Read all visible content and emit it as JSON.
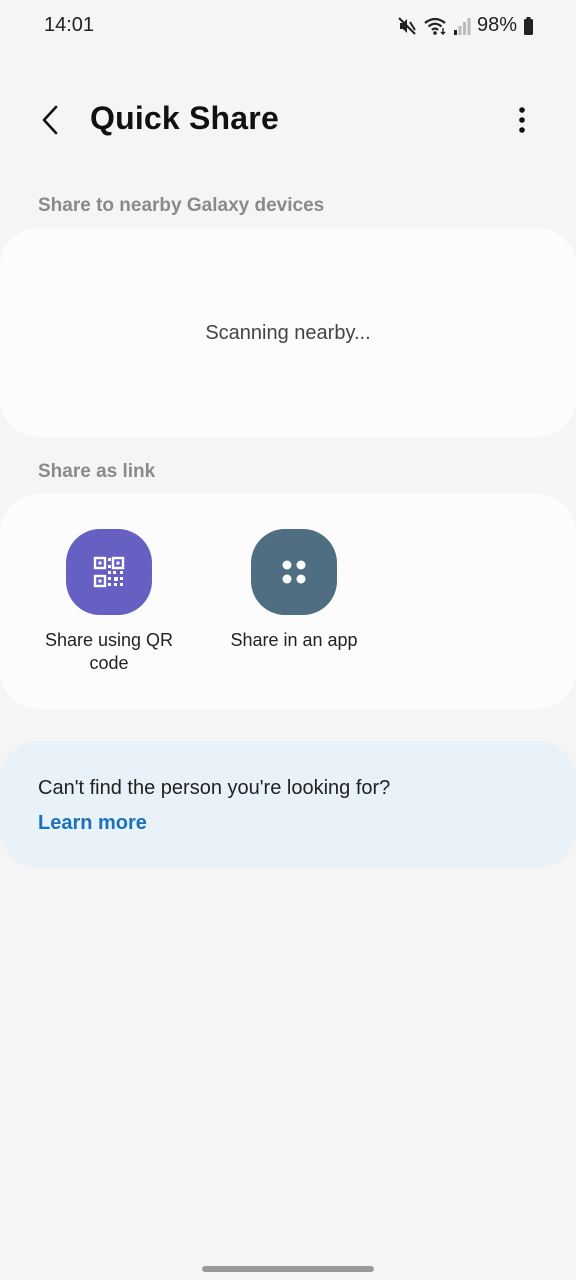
{
  "status_bar": {
    "time": "14:01",
    "battery": "98%",
    "icons": [
      "mute-icon",
      "wifi-icon",
      "signal-icon",
      "battery-icon"
    ]
  },
  "header": {
    "title": "Quick Share",
    "back_icon": "chevron-left-icon",
    "more_icon": "more-vert-icon"
  },
  "nearby": {
    "label": "Share to nearby Galaxy devices",
    "status": "Scanning nearby..."
  },
  "link": {
    "label": "Share as link",
    "options": [
      {
        "label": "Share using QR code",
        "icon": "qr-code-icon",
        "color": "#6560c2"
      },
      {
        "label": "Share in an app",
        "icon": "apps-grid-icon",
        "color": "#4f6e82"
      }
    ]
  },
  "help": {
    "text": "Can't find the person you're looking for?",
    "link": "Learn more",
    "link_color": "#1a72bd"
  }
}
